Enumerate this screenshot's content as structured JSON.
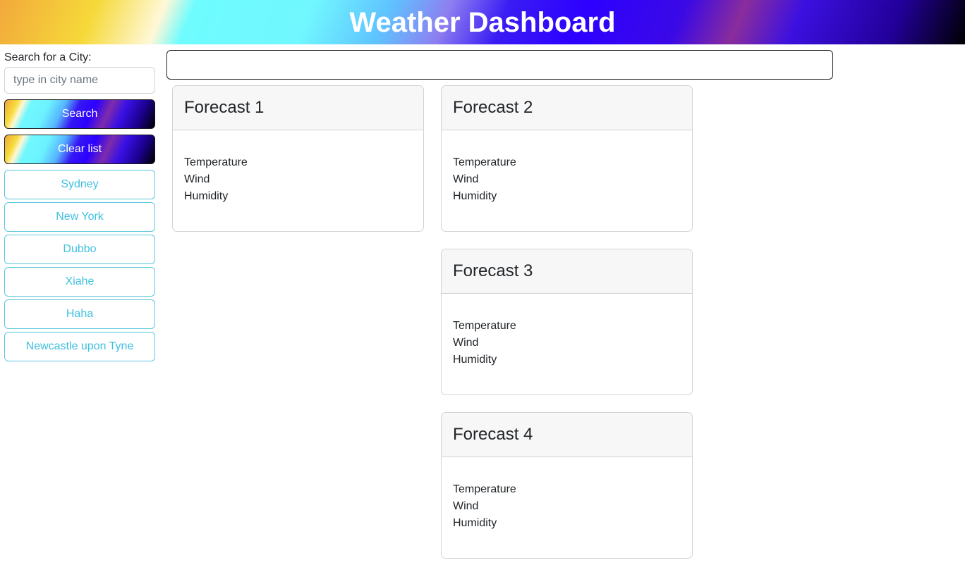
{
  "header": {
    "title": "Weather Dashboard"
  },
  "sidebar": {
    "search_label": "Search for a City:",
    "input_placeholder": "type in city name",
    "input_value": "",
    "search_button": "Search",
    "clear_button": "Clear list",
    "cities": [
      "Sydney",
      "New York",
      "Dubbo",
      "Xiahe",
      "Haha",
      "Newcastle upon Tyne"
    ]
  },
  "current": {
    "text": ""
  },
  "forecasts": [
    {
      "title": "Forecast 1",
      "temperature": "Temperature",
      "wind": "Wind",
      "humidity": "Humidity"
    },
    {
      "title": "Forecast 2",
      "temperature": "Temperature",
      "wind": "Wind",
      "humidity": "Humidity"
    },
    {
      "title": "Forecast 3",
      "temperature": "Temperature",
      "wind": "Wind",
      "humidity": "Humidity"
    },
    {
      "title": "Forecast 4",
      "temperature": "Temperature",
      "wind": "Wind",
      "humidity": "Humidity"
    }
  ],
  "colors": {
    "city_button_text": "#3fc0e0",
    "city_button_border": "#5bc7dd",
    "header_text": "#ffffff"
  }
}
